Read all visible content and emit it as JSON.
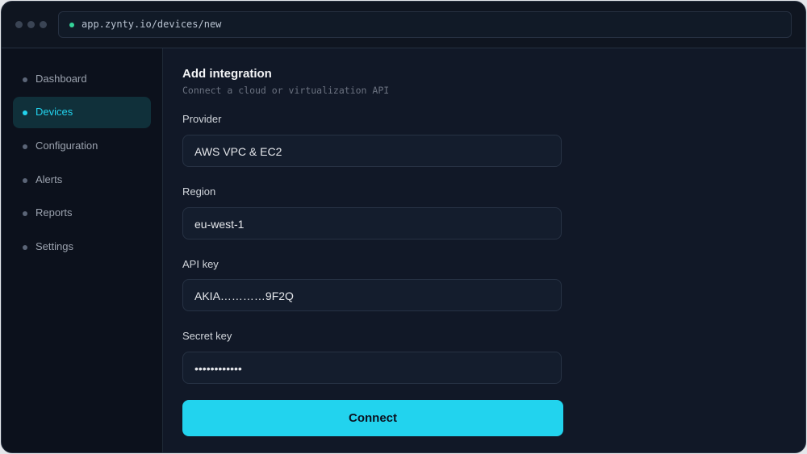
{
  "browser": {
    "url": "app.zynty.io/devices/new"
  },
  "sidebar": {
    "items": [
      {
        "label": "Dashboard",
        "active": false
      },
      {
        "label": "Devices",
        "active": true
      },
      {
        "label": "Configuration",
        "active": false
      },
      {
        "label": "Alerts",
        "active": false
      },
      {
        "label": "Reports",
        "active": false
      },
      {
        "label": "Settings",
        "active": false
      }
    ]
  },
  "main": {
    "title": "Add integration",
    "subtitle": "Connect a cloud or virtualization API",
    "fields": {
      "provider": {
        "label": "Provider",
        "value": "AWS VPC & EC2"
      },
      "region": {
        "label": "Region",
        "value": "eu-west-1"
      },
      "api_key": {
        "label": "API key",
        "value": "AKIA…………9F2Q"
      },
      "secret_key": {
        "label": "Secret key",
        "value": "••••••••••••"
      }
    },
    "connect_label": "Connect"
  },
  "colors": {
    "accent": "#22d3ee",
    "status_secure": "#34d399",
    "background": "#111827",
    "sidebar": "#0c111c"
  }
}
